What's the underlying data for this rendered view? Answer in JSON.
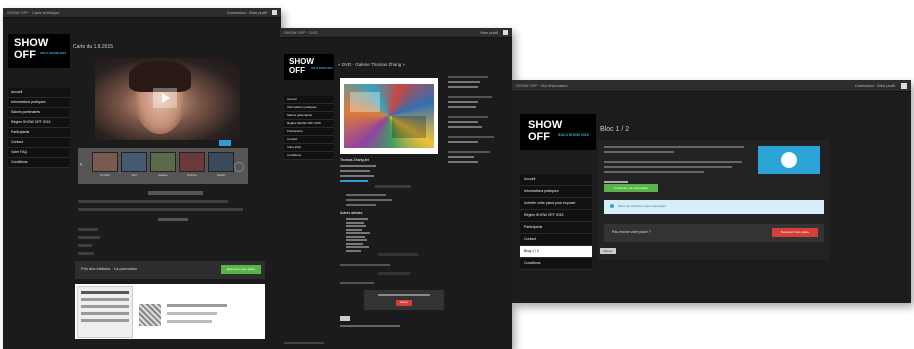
{
  "win1": {
    "tab_title": "SHOW OFF · Carte Artistique",
    "user": "Connexion · Mon profil",
    "logo_line1": "SHOW",
    "logo_line2": "OFF",
    "logo_tag": "SOLO SHOW 2015",
    "nav": [
      "Accueil",
      "Informations pratiques",
      "Salons partenaires",
      "Régles SHOW OFF 2015",
      "Participants",
      "Contact",
      "Votre FAQ",
      "Conditions"
    ],
    "page_title": "Carte du 1.8.2015",
    "thumb_labels": [
      "Portrait",
      "Nuit",
      "Galerie",
      "Archive",
      "Studio"
    ],
    "cta_label": "Prix des éditions · La promotion",
    "cta_button": "Réservez votre place"
  },
  "win2": {
    "tab_title": "SHOW OFF · DVD",
    "user": "Mon profil",
    "logo_line1": "SHOW",
    "logo_line2": "OFF",
    "logo_tag": "SOLO SHOW 2015",
    "nav": [
      "Accueil",
      "Informations pratiques",
      "Salons partenaires",
      "Régles SHOW OFF 2015",
      "Participants",
      "Contact",
      "Votre FAQ",
      "Conditions"
    ],
    "page_title": "« DVD · Galerie Thomas Zhang »",
    "info_title": "Thomas Zhang Art",
    "section_label": "Autres artistes",
    "red_button": "Acheter"
  },
  "win3": {
    "tab_title": "SHOW OFF · Ma réservation",
    "user": "Connexion · Mon profil",
    "logo_line1": "SHOW",
    "logo_line2": "OFF",
    "logo_tag": "SOLO SHOW 2015",
    "nav": [
      "Accueil",
      "Informations pratiques",
      "Acheter votre place pour exposer",
      "Régles SHOW OFF 2015",
      "Participants",
      "Contact",
      "Blog 1 / 2",
      "Conditions"
    ],
    "active_index": 6,
    "page_title": "Bloc 1 / 2",
    "green_button": "Confirmer ma réservation",
    "info_bar": "Merci de confirmer votre réservation",
    "confirm_label": "Pas encore votre place ?",
    "red_button": "Réservez votre place",
    "back_link": "Retour"
  }
}
